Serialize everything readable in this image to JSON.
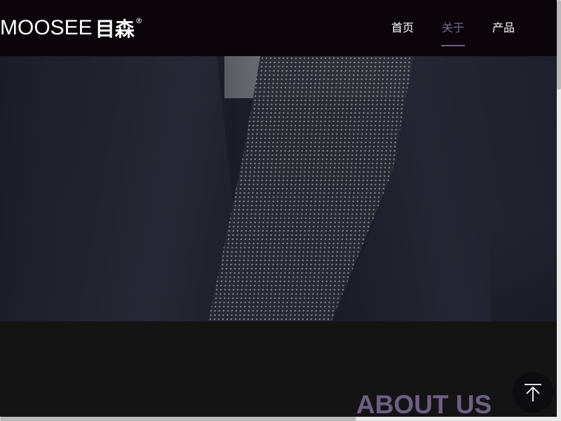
{
  "header": {
    "logo_latin": "MOOSEE",
    "logo_cjk": "目森",
    "logo_reg": "®"
  },
  "nav": {
    "items": [
      {
        "label": "首页",
        "active": false
      },
      {
        "label": "关于",
        "active": true
      },
      {
        "label": "产品",
        "active": false
      }
    ]
  },
  "about": {
    "title": "ABOUT US"
  },
  "back_to_top": {
    "icon": "arrow-up-icon"
  },
  "colors": {
    "header_bg": "#0b040b",
    "accent": "#6e5f86",
    "section_bg": "#141414"
  }
}
